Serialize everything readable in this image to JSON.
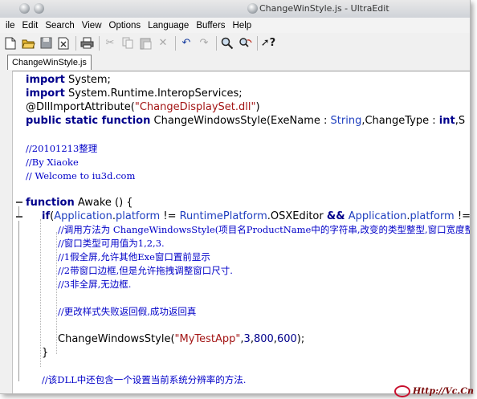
{
  "window": {
    "title": "ChangeWinStyle.js - UltraEdit"
  },
  "menu": [
    "ile",
    "Edit",
    "Search",
    "View",
    "Options",
    "Language",
    "Buffers",
    "Help"
  ],
  "toolbar": {
    "icons": [
      "new-file",
      "open-folder",
      "save",
      "close-file",
      "print",
      "cut",
      "copy",
      "paste",
      "delete",
      "undo",
      "redo",
      "find",
      "replace",
      "help"
    ]
  },
  "tab": {
    "label": "ChangeWinStyle.js"
  },
  "code": {
    "l1": [
      "import",
      " System;"
    ],
    "l2": [
      "import",
      " System.Runtime.InteropServices;"
    ],
    "l3": [
      "@DllImportAttribute(",
      "\"ChangeDisplaySet.dll\"",
      ")"
    ],
    "l4": [
      "public static function",
      " ChangeWindowsStyle(ExeName : ",
      "String",
      ",ChangeType : ",
      "int",
      ",S"
    ],
    "l5": "//20101213整理",
    "l6": "//By Xiaoke",
    "l7": "// Welcome to iu3d.com",
    "l8": [
      "function",
      " Awake () {"
    ],
    "l9": [
      "if",
      "(",
      "Application",
      ".",
      "platform",
      " != ",
      "RuntimePlatform",
      ".OSXEditor ",
      "&&",
      " ",
      "Application",
      ".",
      "platform",
      " !="
    ],
    "l10": "//调用方法为 ChangeWindowsStyle(项目名ProductName中的字符串,改变的类型整型,窗口宽度整",
    "l11": "//窗口类型可用值为1,2,3.",
    "l12": "//1假全屏,允许其他Exe窗口置前显示",
    "l13": "//2带窗口边框,但是允许拖拽调整窗口尺寸.",
    "l14": "//3非全屏,无边框.",
    "l15": "//更改样式失败返回假,成功返回真",
    "l16": [
      "ChangeWindowsStyle(",
      "\"MyTestApp\"",
      ",",
      "3",
      ",",
      "800",
      ",",
      "600",
      ");"
    ],
    "l17": "}",
    "l18": "//该DLL中还包含一个设置当前系统分辨率的方法."
  },
  "watermark": "Http://Vc.Cn"
}
